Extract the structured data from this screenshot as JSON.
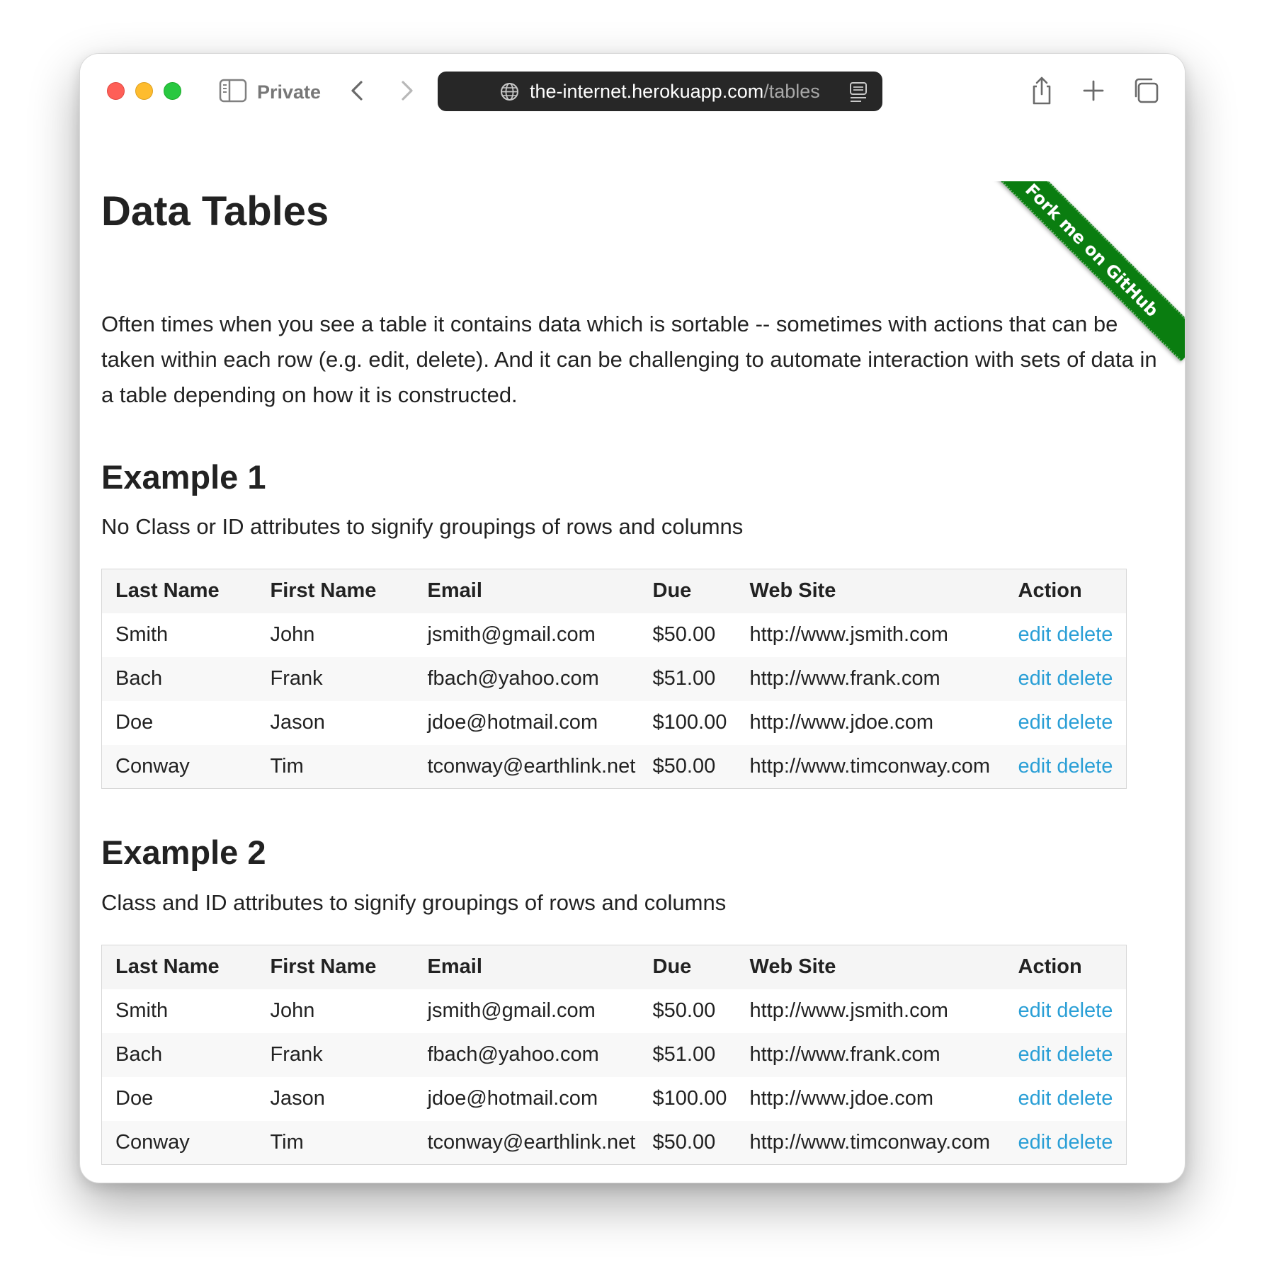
{
  "browser": {
    "mode_label": "Private",
    "url_host": "the-internet.herokuapp.com",
    "url_path": "/tables",
    "accent_colors": {
      "close": "#fe5f57",
      "minimize": "#febc2e",
      "zoom": "#28c840"
    }
  },
  "ribbon": {
    "label": "Fork me on GitHub",
    "color": "#0a7d10"
  },
  "page": {
    "title": "Data Tables",
    "intro": "Often times when you see a table it contains data which is sortable -- sometimes with actions that can be taken within each row (e.g. edit, delete). And it can be challenging to automate interaction with sets of data in a table depending on how it is constructed."
  },
  "examples": [
    {
      "heading": "Example 1",
      "description": "No Class or ID attributes to signify groupings of rows and columns"
    },
    {
      "heading": "Example 2",
      "description": "Class and ID attributes to signify groupings of rows and columns"
    }
  ],
  "table": {
    "headers": [
      "Last Name",
      "First Name",
      "Email",
      "Due",
      "Web Site",
      "Action"
    ],
    "rows": [
      {
        "last": "Smith",
        "first": "John",
        "email": "jsmith@gmail.com",
        "due": "$50.00",
        "web": "http://www.jsmith.com",
        "edit": "edit",
        "delete": "delete"
      },
      {
        "last": "Bach",
        "first": "Frank",
        "email": "fbach@yahoo.com",
        "due": "$51.00",
        "web": "http://www.frank.com",
        "edit": "edit",
        "delete": "delete"
      },
      {
        "last": "Doe",
        "first": "Jason",
        "email": "jdoe@hotmail.com",
        "due": "$100.00",
        "web": "http://www.jdoe.com",
        "edit": "edit",
        "delete": "delete"
      },
      {
        "last": "Conway",
        "first": "Tim",
        "email": "tconway@earthlink.net",
        "due": "$50.00",
        "web": "http://www.timconway.com",
        "edit": "edit",
        "delete": "delete"
      }
    ],
    "link_color": "#2a9fd6"
  }
}
